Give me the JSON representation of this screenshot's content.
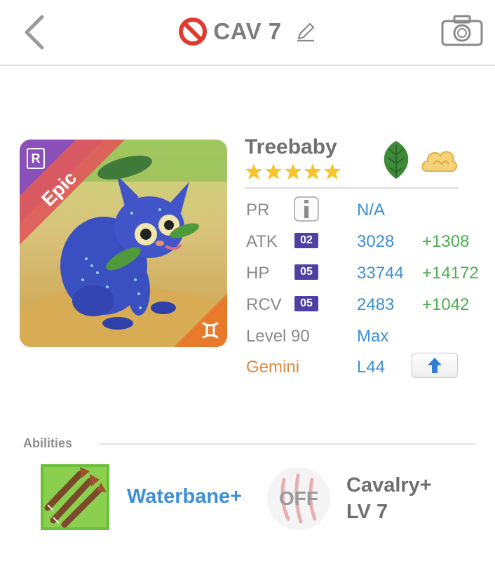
{
  "header": {
    "title": "CAV 7"
  },
  "monster": {
    "name": "Treebaby",
    "rarity": "Epic",
    "rarity_badge": "R",
    "stars": 5,
    "element": "leaf-icon",
    "type": "cloud-icon",
    "sign_icon": "gemini-icon"
  },
  "stats": {
    "pr": {
      "label": "PR",
      "value": "N/A"
    },
    "atk": {
      "label": "ATK",
      "badge": "02",
      "value": "3028",
      "bonus": "+1308"
    },
    "hp": {
      "label": "HP",
      "badge": "05",
      "value": "33744",
      "bonus": "+14172"
    },
    "rcv": {
      "label": "RCV",
      "badge": "05",
      "value": "2483",
      "bonus": "+1042"
    },
    "level": {
      "label": "Level 90",
      "value": "Max"
    },
    "sign": {
      "label": "Gemini",
      "value": "L44"
    }
  },
  "abilities": {
    "heading": "Abilities",
    "ability_name": "Waterbane+",
    "skill_state": "OFF",
    "skill_name": "Cavalry+",
    "skill_level": "LV 7"
  },
  "colors": {
    "accent_blue": "#3d8fd6",
    "bonus_green": "#4caf50",
    "badge_purple": "#5140a3",
    "gemini_orange": "#e08a3c",
    "ban_red": "#e03a2e"
  }
}
